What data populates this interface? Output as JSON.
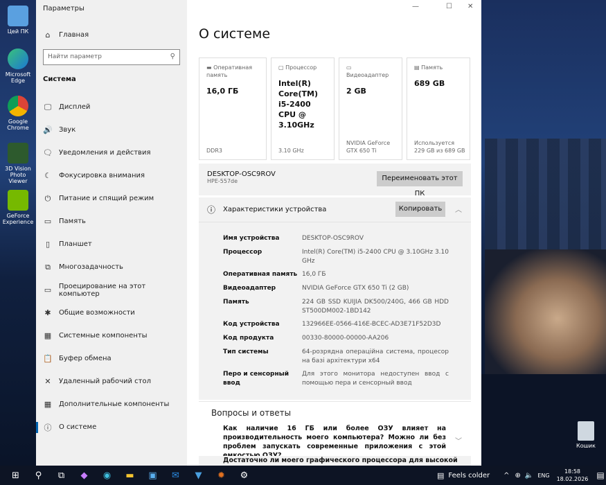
{
  "desktop": {
    "icons": [
      {
        "label": "Цей ПК"
      },
      {
        "label": "Microsoft Edge"
      },
      {
        "label": "Google Chrome"
      },
      {
        "label": "3D Vision Photo Viewer"
      },
      {
        "label": "GeForce Experience"
      }
    ],
    "recycle": "Кошик"
  },
  "window": {
    "title": "Параметры",
    "minimize": "—",
    "maximize": "☐",
    "close": "✕"
  },
  "sidebar": {
    "home": "Главная",
    "search_placeholder": "Найти параметр",
    "section": "Система",
    "items": [
      {
        "label": "Дисплей",
        "icon": "🖵"
      },
      {
        "label": "Звук",
        "icon": "🔊"
      },
      {
        "label": "Уведомления и действия",
        "icon": "🗨"
      },
      {
        "label": "Фокусировка внимания",
        "icon": "☾"
      },
      {
        "label": "Питание и спящий режим",
        "icon": "⏻"
      },
      {
        "label": "Память",
        "icon": "▭"
      },
      {
        "label": "Планшет",
        "icon": "▯"
      },
      {
        "label": "Многозадачность",
        "icon": "⧉"
      },
      {
        "label": "Проецирование на этот компьютер",
        "icon": "▭"
      },
      {
        "label": "Общие возможности",
        "icon": "✱"
      },
      {
        "label": "Системные компоненты",
        "icon": "▦"
      },
      {
        "label": "Буфер обмена",
        "icon": "📋"
      },
      {
        "label": "Удаленный рабочий стол",
        "icon": "✕"
      },
      {
        "label": "Дополнительные компоненты",
        "icon": "▦"
      },
      {
        "label": "О системе",
        "icon": "ⓘ"
      }
    ]
  },
  "main": {
    "title": "О системе",
    "cards": [
      {
        "label": "Оперативная память",
        "value": "16,0 ГБ",
        "sub": "DDR3"
      },
      {
        "label": "Процессор",
        "value": "Intel(R) Core(TM) i5-2400 CPU @ 3.10GHz",
        "sub": "3.10 GHz"
      },
      {
        "label": "Видеоадаптер",
        "value": "2 GB",
        "sub": "NVIDIA GeForce GTX 650 Ti"
      },
      {
        "label": "Память",
        "value": "689 GB",
        "sub": "Используется 229 GB из 689 GB"
      }
    ],
    "pc_name": "DESKTOP-OSC9ROV",
    "pc_model": "HPE-557de",
    "rename_button": "Переименовать этот ПК",
    "specs_title": "Характеристики устройства",
    "copy_button": "Копировать",
    "specs": [
      {
        "k": "Имя устройства",
        "v": "DESKTOP-OSC9ROV"
      },
      {
        "k": "Процессор",
        "v": "Intel(R) Core(TM) i5-2400 CPU @ 3.10GHz   3.10 GHz"
      },
      {
        "k": "Оперативная память",
        "v": "16,0 ГБ"
      },
      {
        "k": "Видеоадаптер",
        "v": "NVIDIA GeForce GTX 650 Ti  (2 GB)"
      },
      {
        "k": "Память",
        "v": "224 GB SSD KUIJIA DK500/240G, 466 GB HDD ST500DM002-1BD142"
      },
      {
        "k": "Код устройства",
        "v": "132966EE-0566-416E-BCEC-AD3E71F52D3D"
      },
      {
        "k": "Код продукта",
        "v": "00330-80000-00000-AA206"
      },
      {
        "k": "Тип системы",
        "v": "64-розрядна операційна система, процесор на базі архітектури x64"
      },
      {
        "k": "Перо и сенсорный ввод",
        "v": "Для этого монитора недоступен ввод с помощью пера и сенсорный ввод"
      }
    ],
    "faq_title": "Вопросы и ответы",
    "faq": [
      "Как наличие 16 ГБ или более ОЗУ влияет на производительность моего компьютера? Можно ли без проблем запускать современные приложения с этой емкостью ОЗУ?",
      "Достаточно ли моего графического процессора для высокой"
    ]
  },
  "taskbar": {
    "weather": "Feels colder",
    "lang": "ENG",
    "time": "18:58",
    "date": "18.02.2026"
  }
}
